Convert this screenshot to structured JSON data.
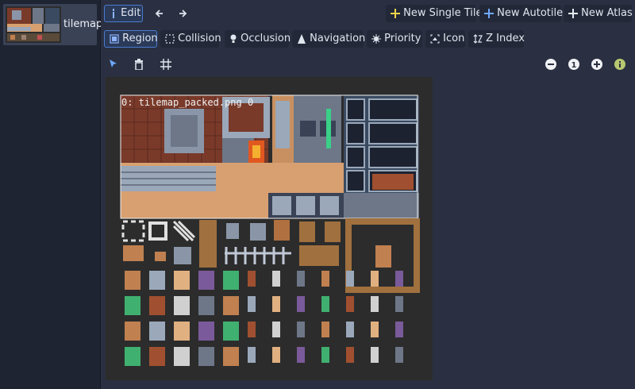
{
  "textures": [
    {
      "name": "tilemap"
    }
  ],
  "toolbar": {
    "edit_label": "Edit",
    "new_single_tile": "New Single Tile",
    "new_autotile": "New Autotile",
    "new_atlas": "New Atlas"
  },
  "modes": [
    {
      "label": "Region",
      "icon": "region-icon",
      "selected": true
    },
    {
      "label": "Collision",
      "icon": "collision-icon",
      "selected": false
    },
    {
      "label": "Occlusion",
      "icon": "occlusion-icon",
      "selected": false
    },
    {
      "label": "Navigation",
      "icon": "navigation-icon",
      "selected": false
    },
    {
      "label": "Priority",
      "icon": "priority-icon",
      "selected": false
    },
    {
      "label": "Icon",
      "icon": "icon-mode-icon",
      "selected": false
    },
    {
      "label": "Z Index",
      "icon": "z-index-icon",
      "selected": false
    }
  ],
  "zoom": {
    "reset_label": "1"
  },
  "canvas": {
    "region_label": "0: tilemap_packed.png 0"
  },
  "colors": {
    "accent": "#4a7bd0",
    "add": "#f2d24b",
    "panel": "#2a3041"
  }
}
